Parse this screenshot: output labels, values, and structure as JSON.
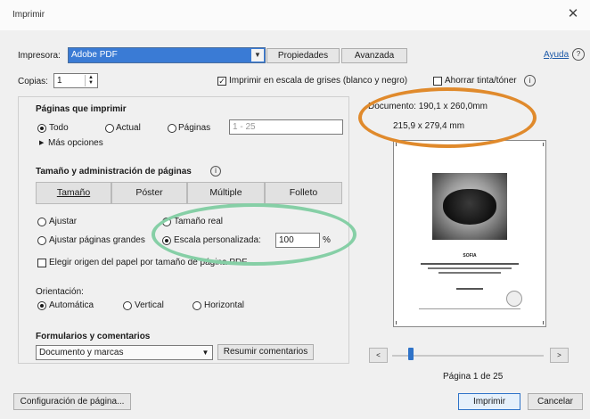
{
  "window": {
    "title": "Imprimir"
  },
  "printer": {
    "label": "Impresora:",
    "value": "Adobe PDF",
    "properties_button": "Propiedades",
    "advanced_button": "Avanzada",
    "help_link": "Ayuda"
  },
  "copies": {
    "label": "Copias:",
    "value": "1",
    "grayscale_label": "Imprimir en escala de grises (blanco y negro)",
    "save_ink_label": "Ahorrar tinta/tóner"
  },
  "document_info": {
    "doc_size": "Documento: 190,1 x 260,0mm",
    "paper_size": "215,9 x 279,4 mm"
  },
  "pages_to_print": {
    "heading": "Páginas que imprimir",
    "all_label": "Todo",
    "current_label": "Actual",
    "pages_label": "Páginas",
    "pages_value": "1 - 25",
    "more_options": "Más opciones"
  },
  "page_sizing": {
    "heading": "Tamaño y administración de páginas",
    "tabs": [
      "Tamaño",
      "Póster",
      "Múltiple",
      "Folleto"
    ],
    "fit_label": "Ajustar",
    "actual_size_label": "Tamaño real",
    "shrink_label": "Ajustar páginas grandes",
    "custom_scale_label": "Escala personalizada:",
    "custom_scale_value": "100",
    "percent": "%",
    "paper_source_label": "Elegir origen del papel por tamaño de página PDF"
  },
  "orientation": {
    "heading": "Orientación:",
    "auto_label": "Automática",
    "portrait_label": "Vertical",
    "landscape_label": "Horizontal"
  },
  "forms": {
    "heading": "Formularios y comentarios",
    "select_value": "Documento y marcas",
    "summarize_button": "Resumir comentarios"
  },
  "preview": {
    "page_title": "SOFIA",
    "page_indicator": "Página 1 de 25",
    "prev_label": "<",
    "next_label": ">",
    "slider_position": 0
  },
  "footer": {
    "page_setup_button": "Configuración de página...",
    "print_button": "Imprimir",
    "cancel_button": "Cancelar"
  },
  "colors": {
    "printer_highlight": "#3a7bd5",
    "annotation_orange": "#e08a2c",
    "annotation_green": "#86cfa6",
    "slider_thumb": "#2f73c8"
  }
}
